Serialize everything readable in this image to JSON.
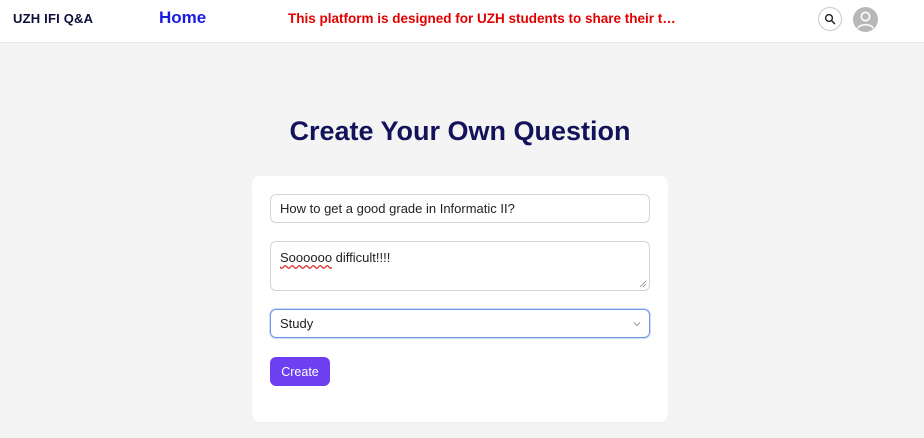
{
  "header": {
    "brand": "UZH IFI Q&A",
    "home_link": "Home",
    "notice": "This platform is designed for UZH students to share their thoug...",
    "search_icon": "search-icon",
    "avatar_icon": "user-avatar-icon"
  },
  "main": {
    "title": "Create Your Own Question",
    "form": {
      "title_value": "How to get a good grade in Informatic II?",
      "body_misspelled": "Soooooo",
      "body_rest": " difficult!!!!",
      "category_value": "Study",
      "create_label": "Create"
    }
  },
  "colors": {
    "brand_text": "#0e0e3a",
    "home_link": "#1a1ae6",
    "notice_red": "#e00000",
    "title": "#13135c",
    "create_button": "#6c3ff0",
    "select_focus_border": "#6f9be8"
  }
}
